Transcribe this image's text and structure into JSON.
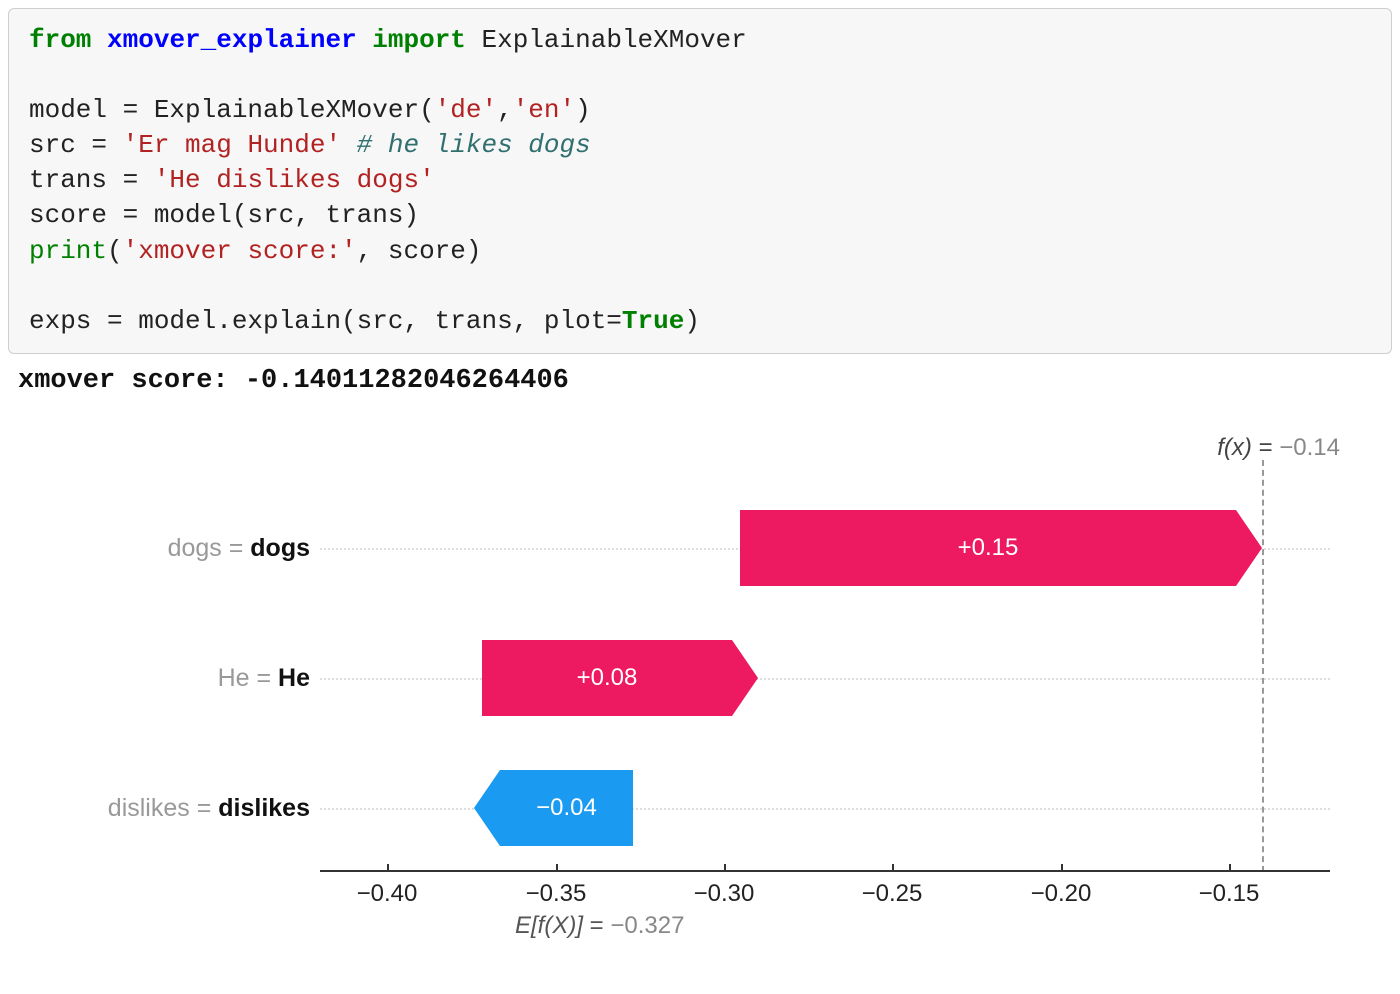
{
  "code": {
    "from": "from",
    "module": "xmover_explainer",
    "import": "import",
    "classname": "ExplainableXMover",
    "line_model_lhs": "model = ExplainableXMover(",
    "arg_de": "'de'",
    "comma1": ",",
    "arg_en": "'en'",
    "rparen1": ")",
    "line_src_lhs": "src = ",
    "src_str": "'Er mag Hunde'",
    "src_comment": " # he likes dogs",
    "line_trans_lhs": "trans = ",
    "trans_str": "'He dislikes dogs'",
    "line_score": "score = model(src, trans)",
    "print_fn": "print",
    "print_open": "(",
    "print_str": "'xmover score:'",
    "print_rest": ", score)",
    "line_exps_lhs": "exps = model.explain(src, trans, plot=",
    "true_kw": "True",
    "line_exps_close": ")"
  },
  "output": "xmover score: -0.14011282046264406",
  "chart": {
    "fx_symbol": "f(x)",
    "fx_eq": " = ",
    "fx_value": "−0.14",
    "ef_symbol": "E[f(X)]",
    "ef_eq": " = ",
    "ef_value": "−0.327",
    "ticks": [
      "−0.40",
      "−0.35",
      "−0.30",
      "−0.25",
      "−0.20",
      "−0.15"
    ],
    "rows": {
      "r0": {
        "left_grey": "dogs = ",
        "left_bold": "dogs",
        "value_label": "+0.15"
      },
      "r1": {
        "left_grey": "He = ",
        "left_bold": "He",
        "value_label": "+0.08"
      },
      "r2": {
        "left_grey": "dislikes = ",
        "left_bold": "dislikes",
        "value_label": "−0.04"
      }
    }
  },
  "chart_data": {
    "type": "bar",
    "title": "",
    "xlabel": "E[f(X)] = -0.327",
    "ylabel": "",
    "xlim": [
      -0.42,
      -0.12
    ],
    "base_value": -0.327,
    "fx_value": -0.14,
    "series": [
      {
        "name": "dogs",
        "display": "dogs = dogs",
        "contribution": 0.15,
        "start": -0.29,
        "end": -0.14,
        "color": "#ed1961"
      },
      {
        "name": "He",
        "display": "He = He",
        "contribution": 0.08,
        "start": -0.367,
        "end": -0.29,
        "color": "#ed1961"
      },
      {
        "name": "dislikes",
        "display": "dislikes = dislikes",
        "contribution": -0.04,
        "start": -0.327,
        "end": -0.367,
        "color": "#1a9af0"
      }
    ],
    "x_ticks": [
      -0.4,
      -0.35,
      -0.3,
      -0.25,
      -0.2,
      -0.15
    ],
    "annotations": [
      "f(x) = -0.14"
    ]
  }
}
